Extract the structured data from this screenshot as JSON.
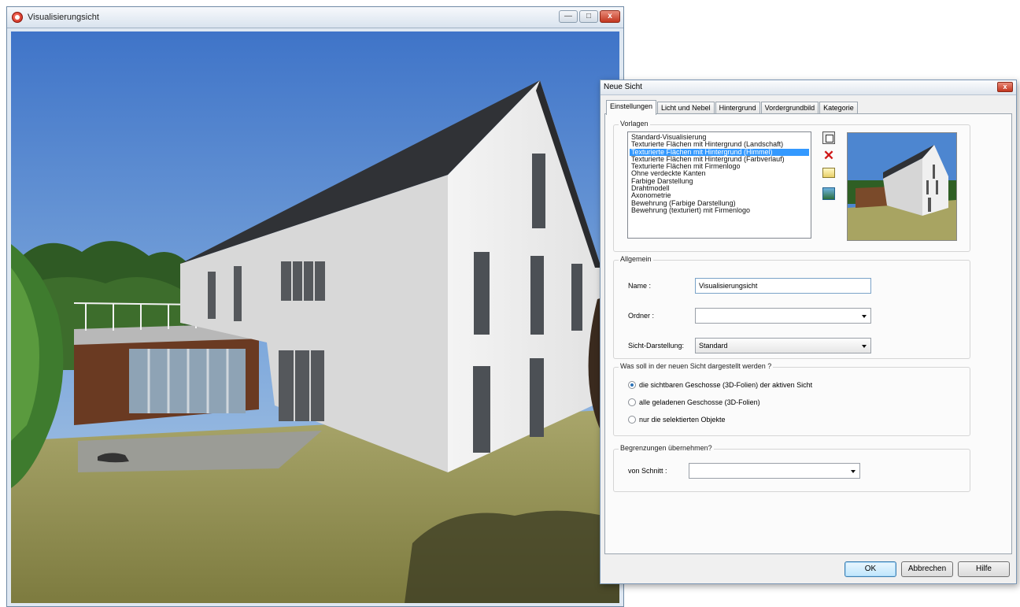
{
  "vis_window": {
    "title": "Visualisierungsicht",
    "buttons": {
      "minimize": "—",
      "maximize": "□",
      "close": "x"
    }
  },
  "dialog": {
    "title": "Neue Sicht",
    "close_glyph": "x",
    "tabs": [
      "Einstellungen",
      "Licht und Nebel",
      "Hintergrund",
      "Vordergrundbild",
      "Kategorie"
    ],
    "active_tab": "Einstellungen",
    "vorlagen": {
      "legend": "Vorlagen",
      "items": [
        "Standard-Visualisierung",
        "Texturierte Flächen mit Hintergrund (Landschaft)",
        "Texturierte Flächen mit Hintergrund (Himmel)",
        "Texturierte Flächen mit Hintergrund (Farbverlauf)",
        "Texturierte Flächen mit Firmenlogo",
        "Ohne verdeckte Kanten",
        "Farbige Darstellung",
        "Drahtmodell",
        "Axonometrie",
        "Bewehrung (Farbige Darstellung)",
        "Bewehrung (texturiert) mit Firmenlogo"
      ],
      "selected_index": 2
    },
    "allgemein": {
      "legend": "Allgemein",
      "name_label": "Name :",
      "name_value": "Visualisierungsicht",
      "ordner_label": "Ordner :",
      "ordner_value": "",
      "sicht_label": "Sicht-Darstellung:",
      "sicht_value": "Standard"
    },
    "darstellung": {
      "legend": "Was soll in der neuen Sicht dargestellt werden ?",
      "options": [
        "die sichtbaren Geschosse (3D-Folien) der aktiven Sicht",
        "alle geladenen Geschosse (3D-Folien)",
        "nur die selektierten Objekte"
      ],
      "selected_index": 0
    },
    "begrenzungen": {
      "legend": "Begrenzungen übernehmen?",
      "schnitt_label": "von Schnitt :",
      "schnitt_value": ""
    },
    "buttons": {
      "ok": "OK",
      "cancel": "Abbrechen",
      "help": "Hilfe"
    }
  }
}
